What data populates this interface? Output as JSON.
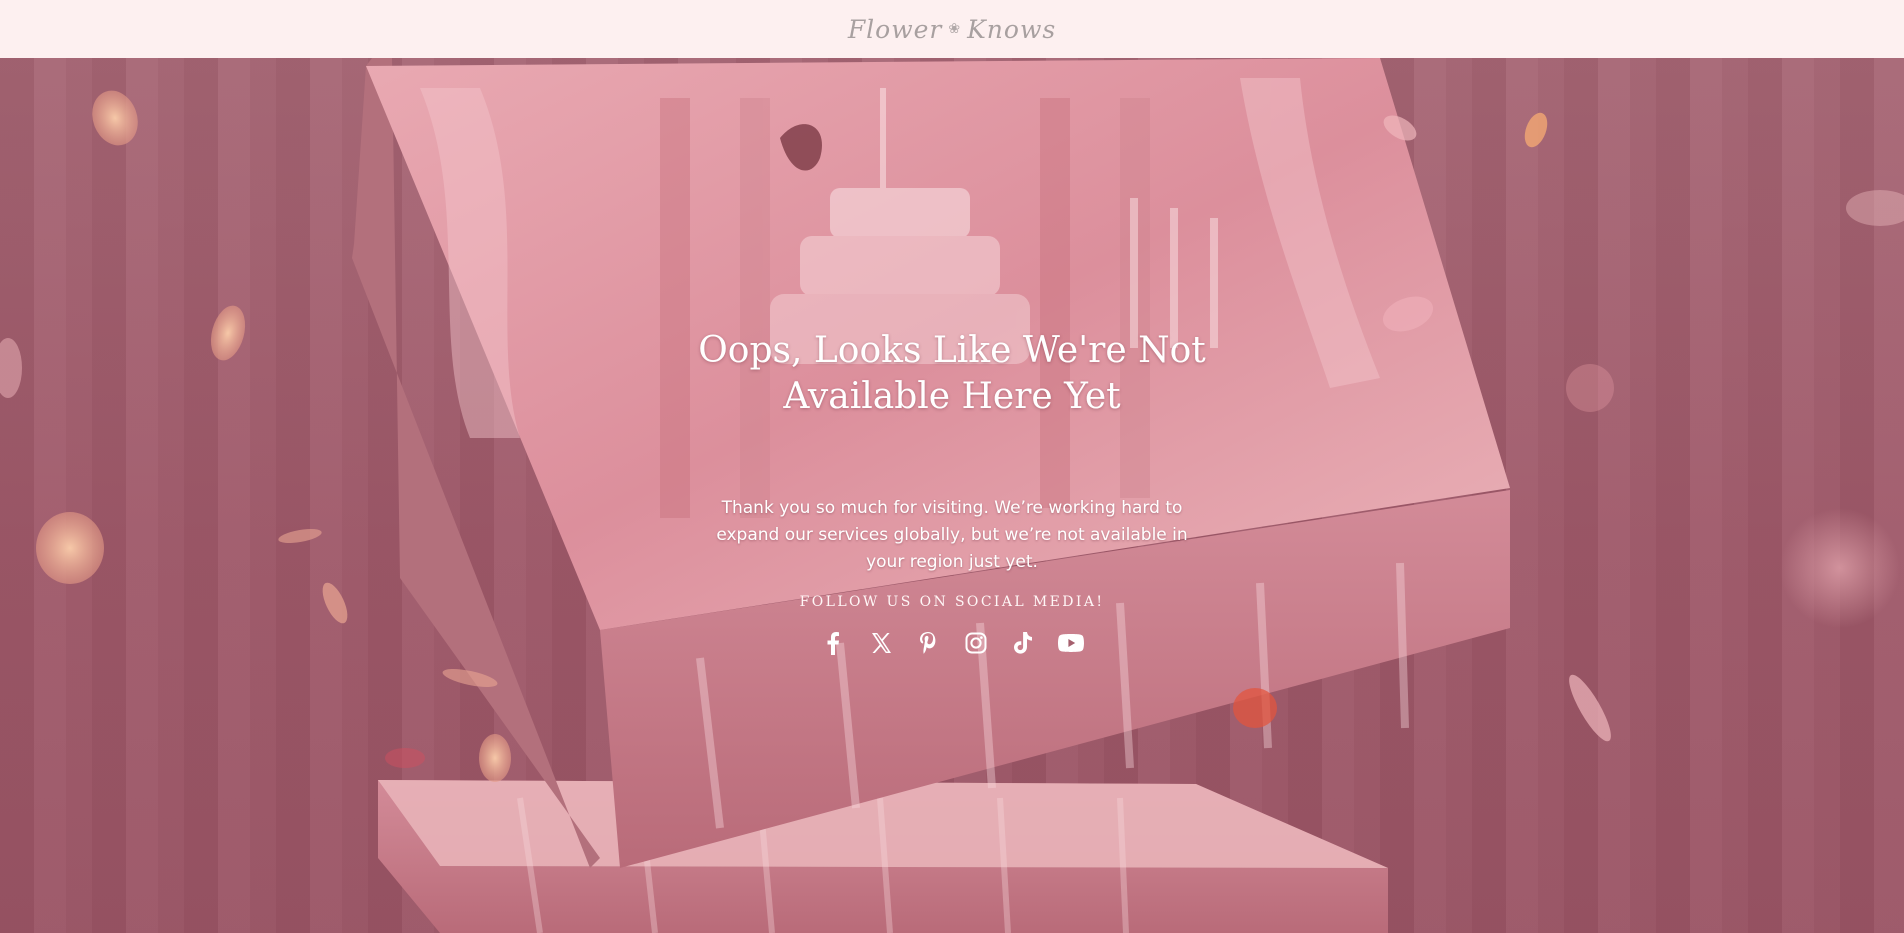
{
  "header": {
    "logo_text_1": "Flower",
    "logo_text_2": "Knows",
    "logo_separator": "❀",
    "background_color": "#fdf0f0",
    "logo_color": "#a8a0a0"
  },
  "hero": {
    "title": "Oops, Looks Like We're Not Available Here Yet",
    "message": "Thank you so much for visiting. We’re working hard to expand our services globally, but we’re not available in your region just yet.",
    "follow_label": "FOLLOW US ON SOCIAL MEDIA!",
    "overlay_color": "#a5606e",
    "text_color": "#ffffff"
  },
  "socials": [
    {
      "name": "facebook",
      "icon": "facebook-icon"
    },
    {
      "name": "x",
      "icon": "x-icon"
    },
    {
      "name": "pinterest",
      "icon": "pinterest-icon"
    },
    {
      "name": "instagram",
      "icon": "instagram-icon"
    },
    {
      "name": "tiktok",
      "icon": "tiktok-icon"
    },
    {
      "name": "youtube",
      "icon": "youtube-icon"
    }
  ]
}
